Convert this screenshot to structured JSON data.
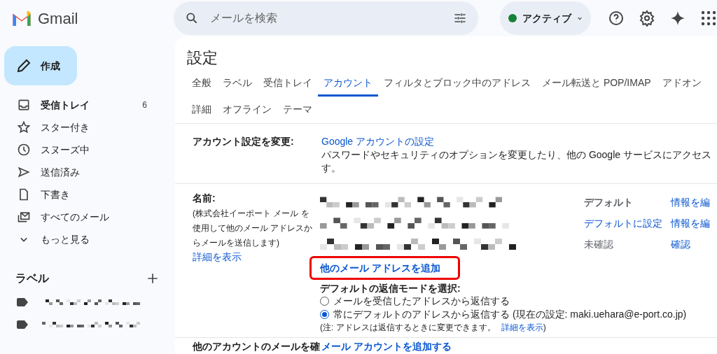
{
  "app": {
    "name": "Gmail"
  },
  "search": {
    "placeholder": "メールを検索"
  },
  "status": {
    "label": "アクティブ",
    "color": "#188038"
  },
  "compose": {
    "label": "作成"
  },
  "nav": [
    {
      "label": "受信トレイ",
      "count": "6",
      "selected": true
    },
    {
      "label": "スター付き",
      "selected": false
    },
    {
      "label": "スヌーズ中",
      "selected": false
    },
    {
      "label": "送信済み",
      "selected": false
    },
    {
      "label": "下書き",
      "selected": false
    },
    {
      "label": "すべてのメール",
      "selected": false
    },
    {
      "label": "もっと見る",
      "selected": false
    }
  ],
  "labels": {
    "title": "ラベル"
  },
  "settings": {
    "title": "設定",
    "tabs": [
      {
        "label": "全般",
        "selected": false
      },
      {
        "label": "ラベル",
        "selected": false
      },
      {
        "label": "受信トレイ",
        "selected": false
      },
      {
        "label": "アカウント",
        "selected": true
      },
      {
        "label": "フィルタとブロック中のアドレス",
        "selected": false
      },
      {
        "label": "メール転送と POP/IMAP",
        "selected": false
      },
      {
        "label": "アドオン",
        "selected": false
      },
      {
        "label": "詳細",
        "selected": false
      },
      {
        "label": "オフライン",
        "selected": false
      },
      {
        "label": "テーマ",
        "selected": false
      }
    ],
    "account": {
      "label": "アカウント設定を変更:",
      "link": "Google アカウントの設定",
      "description": [
        "パスワードやセキュリティのオプションを変更したり、他の Google サービスにアクセス",
        "す。"
      ]
    },
    "name": {
      "label": "名前:",
      "note": "(株式会社イーポート メール を使用して他のメール アドレスからメールを送信します)",
      "details_link": "詳細を表示",
      "addresses": [
        {
          "status": "デフォルト",
          "kind": "label",
          "action": "情報を編"
        },
        {
          "status": "デフォルトに設定",
          "kind": "link",
          "action": "情報を編"
        },
        {
          "status": "未確認",
          "kind": "muted",
          "action": "確認"
        }
      ],
      "add_link": "他のメール アドレスを追加",
      "reply_title": "デフォルトの返信モードを選択:",
      "reply_options": [
        {
          "label": "メールを受信したアドレスから返信する",
          "selected": false
        },
        {
          "label": "常にデフォルトのアドレスから返信する (現在の設定: maki.uehara@e-port.co.jp)",
          "selected": true
        }
      ],
      "reply_note": "(注: アドレスは返信するときに変更できます。",
      "reply_note_link": "詳細を表示",
      "reply_note_end": ")"
    },
    "check_mail": {
      "label": "他のアカウントのメールを確",
      "link": "メール アカウントを追加する"
    }
  }
}
